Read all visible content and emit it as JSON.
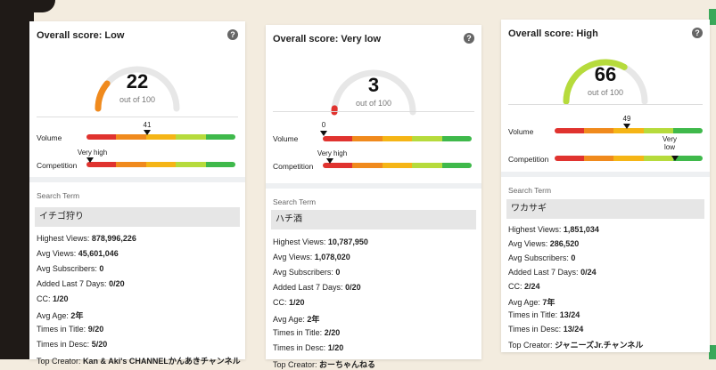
{
  "cards": [
    {
      "title": "Overall score: Low",
      "help_icon": "question-mark-icon",
      "score": "22",
      "out_of": "out of 100",
      "score_value": 22,
      "gauge_color": "#f08a1d",
      "volume": {
        "label": "Volume",
        "marker_text": "41",
        "level": 0.41
      },
      "competition": {
        "label": "Competition",
        "marker_text": "Very high",
        "level": 0.05
      },
      "search_term_label": "Search Term",
      "search_term": "イチゴ狩り",
      "stats": [
        {
          "label": "Highest Views:",
          "value": "878,996,226"
        },
        {
          "label": "Avg Views:",
          "value": "45,601,046"
        },
        {
          "label": "Avg Subscribers:",
          "value": "0"
        },
        {
          "label": "Added Last 7 Days:",
          "value": "0/20"
        },
        {
          "label": "CC:",
          "value": "1/20"
        },
        {
          "label": "Avg Age:",
          "value": "2年"
        },
        {
          "label": "Times in Title:",
          "value": "9/20"
        },
        {
          "label": "Times in Desc:",
          "value": "5/20"
        },
        {
          "label": "Top Creator:",
          "value": "Kan & Aki's CHANNELかんあきチャンネル"
        }
      ]
    },
    {
      "title": "Overall score: Very low",
      "help_icon": "question-mark-icon",
      "score": "3",
      "out_of": "out of 100",
      "score_value": 3,
      "gauge_color": "#e0332f",
      "volume": {
        "label": "Volume",
        "marker_text": "0",
        "level": 0.0
      },
      "competition": {
        "label": "Competition",
        "marker_text": "Very high",
        "level": 0.05
      },
      "search_term_label": "Search Term",
      "search_term": "ハチ酒",
      "stats": [
        {
          "label": "Highest Views:",
          "value": "10,787,950"
        },
        {
          "label": "Avg Views:",
          "value": "1,078,020"
        },
        {
          "label": "Avg Subscribers:",
          "value": "0"
        },
        {
          "label": "Added Last 7 Days:",
          "value": "0/20"
        },
        {
          "label": "CC:",
          "value": "1/20"
        },
        {
          "label": "Avg Age:",
          "value": "2年"
        },
        {
          "label": "Times in Title:",
          "value": "2/20"
        },
        {
          "label": "Times in Desc:",
          "value": "1/20"
        },
        {
          "label": "Top Creator:",
          "value": "おーちゃんねる"
        }
      ]
    },
    {
      "title": "Overall score: High",
      "help_icon": "question-mark-icon",
      "score": "66",
      "out_of": "out of 100",
      "score_value": 66,
      "gauge_color": "#b6db3c",
      "volume": {
        "label": "Volume",
        "marker_text": "49",
        "level": 0.49
      },
      "competition": {
        "label": "Competition",
        "marker_text": "Very low",
        "level": 0.9
      },
      "search_term_label": "Search Term",
      "search_term": "ワカサギ",
      "stats": [
        {
          "label": "Highest Views:",
          "value": "1,851,034"
        },
        {
          "label": "Avg Views:",
          "value": "286,520"
        },
        {
          "label": "Avg Subscribers:",
          "value": "0"
        },
        {
          "label": "Added Last 7 Days:",
          "value": "0/24"
        },
        {
          "label": "CC:",
          "value": "2/24"
        },
        {
          "label": "Avg Age:",
          "value": "7年"
        },
        {
          "label": "Times in Title:",
          "value": "13/24"
        },
        {
          "label": "Times in Desc:",
          "value": "13/24"
        },
        {
          "label": "Top Creator:",
          "value": "ジャニーズJr.チャンネル"
        }
      ]
    }
  ]
}
